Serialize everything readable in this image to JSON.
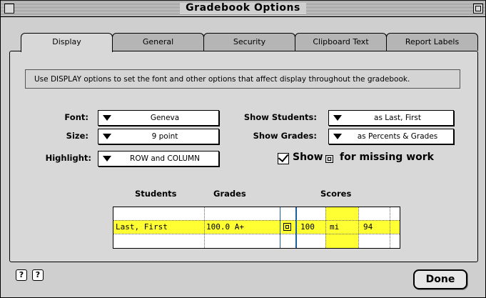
{
  "window": {
    "title": "Gradebook Options"
  },
  "tabs": [
    {
      "label": "Display"
    },
    {
      "label": "General"
    },
    {
      "label": "Security"
    },
    {
      "label": "Clipboard Text"
    },
    {
      "label": "Report Labels"
    }
  ],
  "description": "Use DISPLAY options to set the font and other options that affect display throughout the gradebook.",
  "font": {
    "label": "Font:",
    "value": "Geneva"
  },
  "size": {
    "label": "Size:",
    "value": "9 point"
  },
  "highlight": {
    "label": "Highlight:",
    "value": "ROW and COLUMN"
  },
  "show_students": {
    "label": "Show Students:",
    "value": "as Last, First"
  },
  "show_grades": {
    "label": "Show Grades:",
    "value": "as Percents & Grades"
  },
  "missing_work": {
    "show": "Show",
    "rest": "for missing work",
    "checked": true
  },
  "preview": {
    "headers": {
      "students": "Students",
      "grades": "Grades",
      "scores": "Scores"
    },
    "row": {
      "student": "Last, First",
      "grade": "100.0 A+",
      "score1": "100",
      "score2": "mi",
      "score3": "94"
    },
    "highlight_color": "#ffff33"
  },
  "footer": {
    "done_label": "Done",
    "help1": "?",
    "help2": "?"
  }
}
